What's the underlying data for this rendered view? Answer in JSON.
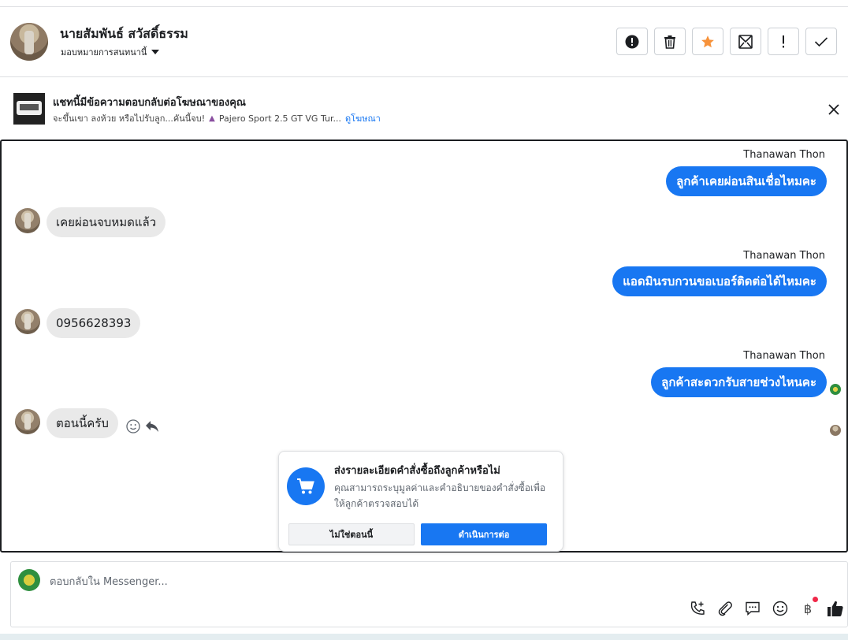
{
  "header": {
    "contact_name": "นายสัมพันธ์ สวัสดิ์ธรรม",
    "assign_label": "มอบหมายการสนทนานี้",
    "actions": [
      {
        "name": "report-icon"
      },
      {
        "name": "trash-icon"
      },
      {
        "name": "star-icon",
        "color": "#f7923a"
      },
      {
        "name": "mark-unread-icon"
      },
      {
        "name": "exclamation-icon"
      },
      {
        "name": "checkmark-icon"
      }
    ]
  },
  "ad_banner": {
    "title": "แชทนี้มีข้อความตอบกลับต่อโฆษณาของคุณ",
    "subtitle": "จะขึ้นเขา ลงห้วย หรือไปรับลูก...คันนี้จบ!",
    "car_model": "Pajero Sport 2.5 GT VG Tur...",
    "link": "ดูโฆษณา"
  },
  "messages": [
    {
      "sender": "Thanawan Thon",
      "text": "ลูกค้าเคยผ่อนสินเชื่อไหมคะ"
    },
    {
      "text": "เคยผ่อนจบหมดแล้ว"
    },
    {
      "sender": "Thanawan Thon",
      "text": "แอดมินรบกวนขอเบอร์ติดต่อได้ไหมคะ"
    },
    {
      "text": "0956628393"
    },
    {
      "sender": "Thanawan Thon",
      "text": "ลูกค้าสะดวกรับสายช่วงไหนคะ"
    },
    {
      "text": "ตอนนี้ครับ"
    }
  ],
  "order_prompt": {
    "title": "ส่งรายละเอียดคำสั่งซื้อถึงลูกค้าหรือไม่",
    "description": "คุณสามารถระบุมูลค่าและคำอธิบายของคำสั่งซื้อเพื่อให้ลูกค้าตรวจสอบได้",
    "decline": "ไม่ใช่ตอนนี้",
    "proceed": "ดำเนินการต่อ"
  },
  "composer": {
    "placeholder": "ตอบกลับใน Messenger...",
    "tools": [
      "phone-plus-icon",
      "paperclip-icon",
      "saved-replies-icon",
      "emoji-icon",
      "baht-payment-icon",
      "thumbs-up-icon"
    ],
    "baht_symbol": "฿"
  },
  "colors": {
    "accent": "#1877f2",
    "star": "#f7923a",
    "incoming_bubble": "#e9e9e9",
    "notification_dot": "#f02849"
  }
}
